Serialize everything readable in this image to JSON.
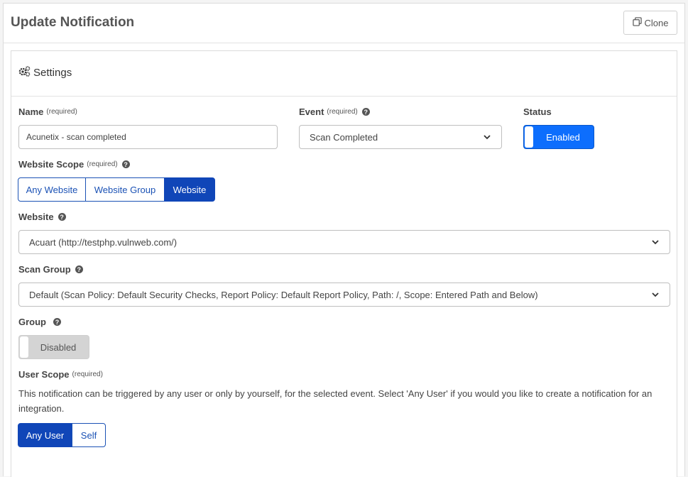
{
  "header": {
    "title": "Update Notification",
    "clone_label": "Clone"
  },
  "settings": {
    "title": "Settings"
  },
  "form": {
    "required_tag": "(required)",
    "name": {
      "label": "Name",
      "value": "Acunetix - scan completed"
    },
    "event": {
      "label": "Event",
      "value": "Scan Completed"
    },
    "status": {
      "label": "Status",
      "value": "Enabled",
      "on": true
    },
    "website_scope": {
      "label": "Website Scope",
      "options": [
        "Any Website",
        "Website Group",
        "Website"
      ],
      "selected": "Website"
    },
    "website": {
      "label": "Website",
      "value": "Acuart (http://testphp.vulnweb.com/)"
    },
    "scan_group": {
      "label": "Scan Group",
      "value": "Default (Scan Policy: Default Security Checks, Report Policy: Default Report Policy, Path: /, Scope: Entered Path and Below)"
    },
    "group": {
      "label": "Group",
      "value": "Disabled",
      "on": false
    },
    "user_scope": {
      "label": "User Scope",
      "description": "This notification can be triggered by any user or only by yourself, for the selected event. Select 'Any User' if you would you like to create a notification for an integration.",
      "options": [
        "Any User",
        "Self"
      ],
      "selected": "Any User"
    }
  },
  "icons": {
    "clone": "clone-icon",
    "settings": "gears-icon",
    "help": "question-circle-icon",
    "dropdown": "chevron-down-icon"
  },
  "colors": {
    "primary": "#0d6efd",
    "segment_active": "#1046b8",
    "toggle_off": "#d4d4d4"
  }
}
